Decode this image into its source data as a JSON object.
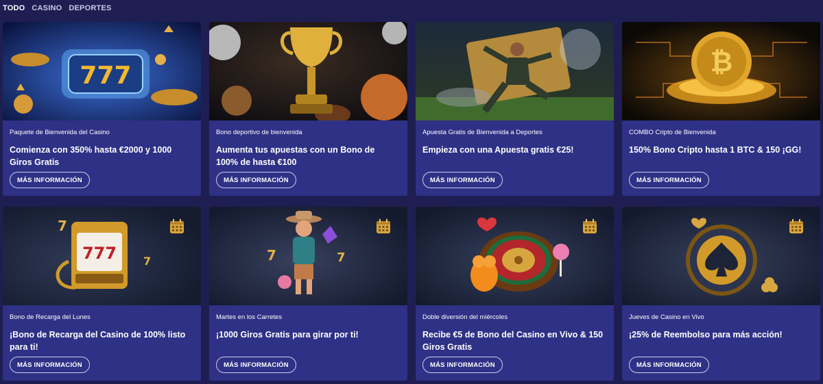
{
  "tabs": [
    "TODO",
    "CASINO",
    "DEPORTES"
  ],
  "cards": [
    {
      "kicker": "Paquete de Bienvenida del Casino",
      "title": "Comienza con 350% hasta €2000 y 1000 Giros Gratis",
      "button": "MÁS INFORMACIÓN",
      "image": "slot-777-lamp"
    },
    {
      "kicker": "Bono deportivo de bienvenida",
      "title": "Aumenta tus apuestas con un Bono de 100% de hasta €100",
      "button": "MÁS INFORMACIÓN",
      "image": "trophy-balls"
    },
    {
      "kicker": "Apuesta Gratis de Bienvenida a Deportes",
      "title": "Empieza con una Apuesta gratis €25!",
      "button": "MÁS INFORMACIÓN",
      "image": "football-player-ticket"
    },
    {
      "kicker": "COMBO Cripto de Bienvenida",
      "title": "150% Bono Cripto hasta 1 BTC & 150 ¡GG!",
      "button": "MÁS INFORMACIÓN",
      "image": "bitcoin-coin"
    },
    {
      "kicker": "Bono de Recarga del Lunes",
      "title": "¡Bono de Recarga del Casino de 100% listo para ti!",
      "button": "MÁS INFORMACIÓN",
      "image": "slot-machine-777"
    },
    {
      "kicker": "Martes en los Carretes",
      "title": "¡1000 Giros Gratis para girar por ti!",
      "button": "MÁS INFORMACIÓN",
      "image": "cowboy-character"
    },
    {
      "kicker": "Doble diversión del miércoles",
      "title": "Recibe €5 de Bono del Casino en Vivo & 150 Giros Gratis",
      "button": "MÁS INFORMACIÓN",
      "image": "roulette-wheel"
    },
    {
      "kicker": "Jueves de Casino en Vivo",
      "title": "¡25% de Reembolso para más acción!",
      "button": "MÁS INFORMACIÓN",
      "image": "poker-chip-spade"
    }
  ],
  "colors": {
    "page_bg": "#1f1e52",
    "card_bg": "#2e3185",
    "accent_gold": "#e7b43a"
  }
}
